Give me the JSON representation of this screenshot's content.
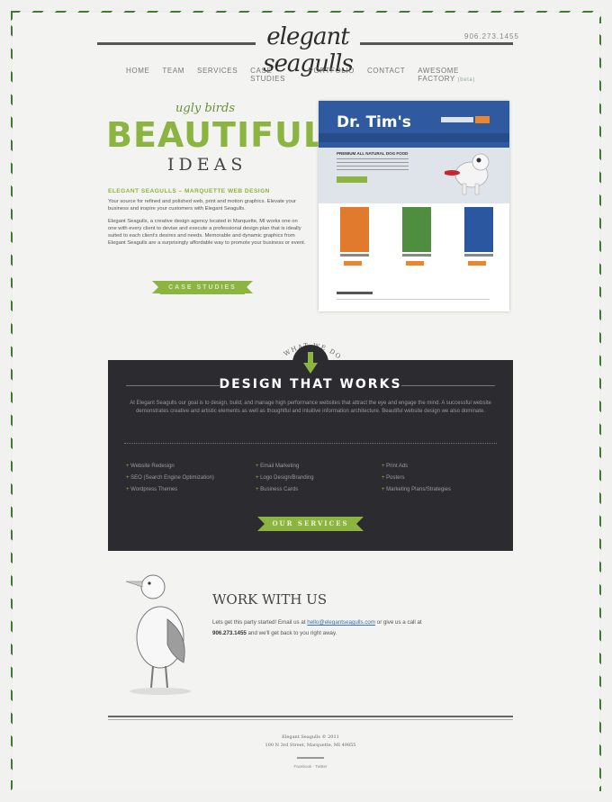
{
  "header": {
    "logo": "elegant seagulls",
    "phone": "906.273.1455"
  },
  "nav": {
    "items": [
      "HOME",
      "TEAM",
      "SERVICES",
      "CASE STUDIES",
      "PORTFOLIO",
      "CONTACT",
      "AWESOME FACTORY"
    ],
    "awesome_sub": "(beta)"
  },
  "hero": {
    "ugly": "ugly birds",
    "beautiful": "BEAUTIFUL",
    "ideas": "IDEAS",
    "tagline": "ELEGANT SEAGULLS – MARQUETTE WEB DESIGN",
    "intro": "Your source for refined and polished web, print and motion graphics. Elevate your business and inspire your customers with Elegant Seagulls.",
    "body": "Elegant Seagulls, a creative design agency located in Marquette, MI works one on one with every client to devise and execute a professional design plan that is ideally suited to each client's desires and needs. Memorable and dynamic graphics from Elegant Seagulls are a surprisingly affordable way to promote your business or event.",
    "button": "CASE STUDIES"
  },
  "showcase": {
    "brand": "Dr. Tim's",
    "headline": "PREMIUM ALL NATURAL DOG FOOD"
  },
  "what_we_do": {
    "arc_label": "WHAT WE DO",
    "title": "DESIGN THAT WORKS",
    "description": "At Elegant Seagulls our goal is to design, build, and manage high performance websites that attract the eye and engage the mind. A successful website demonstrates creative and artistic elements as well as thoughtful and intuitive information architecture. Beautiful website design we also dominate.",
    "col1": [
      "Website Redesign",
      "SEO (Search Engine Optimization)",
      "Wordpress Themes"
    ],
    "col2": [
      "Email Marketing",
      "Logo Design/Branding",
      "Business Cards"
    ],
    "col3": [
      "Print Ads",
      "Posters",
      "Marketing Plans/Strategies"
    ],
    "button": "OUR SERVICES"
  },
  "work": {
    "title": "WORK WITH US",
    "text_pre": "Lets get this party started! Email us at",
    "email": "hello@elegantseagulls.com",
    "text_mid": "or give us a call at",
    "phone": "906.273.1455",
    "text_post": "and we'll get back to you right away."
  },
  "footer": {
    "copyright": "Elegant Seagulls © 2011",
    "address": "100 N 3rd Street, Marquette, MI 49855",
    "social": "Facebook · Twitter"
  },
  "colors": {
    "accent_green": "#8cb440",
    "border_green": "#3f7a33",
    "dark_panel": "#2c2b30",
    "showcase_blue": "#2f5aa0"
  }
}
